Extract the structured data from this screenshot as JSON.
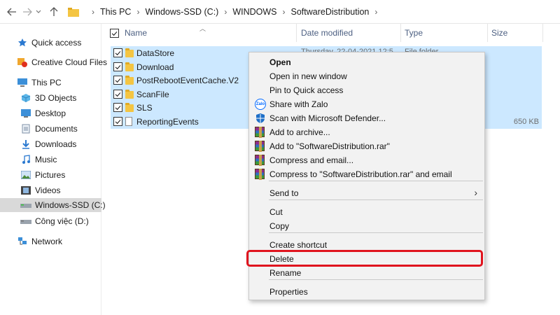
{
  "address": {
    "crumbs": [
      "This PC",
      "Windows-SSD (C:)",
      "WINDOWS",
      "SoftwareDistribution"
    ],
    "icons": {
      "back": "arrow-left-icon",
      "forward": "arrow-right-icon",
      "recent": "chevron-down-icon",
      "up": "arrow-up-icon",
      "folder": "folder-icon",
      "separator": "chevron-right-icon"
    }
  },
  "sidebar": {
    "items": [
      {
        "label": "Quick access",
        "icon": "star-icon"
      },
      {
        "label": "Creative Cloud Files",
        "icon": "creative-cloud-icon"
      },
      {
        "label": "This PC",
        "icon": "computer-icon"
      },
      {
        "label": "3D Objects",
        "icon": "cube-icon"
      },
      {
        "label": "Desktop",
        "icon": "desktop-icon"
      },
      {
        "label": "Documents",
        "icon": "documents-icon"
      },
      {
        "label": "Downloads",
        "icon": "download-icon"
      },
      {
        "label": "Music",
        "icon": "music-icon"
      },
      {
        "label": "Pictures",
        "icon": "pictures-icon"
      },
      {
        "label": "Videos",
        "icon": "video-icon"
      },
      {
        "label": "Windows-SSD (C:)",
        "icon": "drive-icon"
      },
      {
        "label": "Công việc (D:)",
        "icon": "drive-icon"
      },
      {
        "label": "Network",
        "icon": "network-icon"
      }
    ],
    "selected": "Windows-SSD (C:)"
  },
  "columns": {
    "name": "Name",
    "date_modified": "Date modified",
    "type": "Type",
    "size": "Size"
  },
  "files": [
    {
      "name": "DataStore",
      "kind": "folder",
      "size": ""
    },
    {
      "name": "Download",
      "kind": "folder",
      "size": ""
    },
    {
      "name": "PostRebootEventCache.V2",
      "kind": "folder",
      "size": ""
    },
    {
      "name": "ScanFile",
      "kind": "folder",
      "size": ""
    },
    {
      "name": "SLS",
      "kind": "folder",
      "size": ""
    },
    {
      "name": "ReportingEvents",
      "kind": "file",
      "size": "650 KB"
    }
  ],
  "partial_text": {
    "date": "Thursday, 22-04-2021 12:5",
    "type": "File folder"
  },
  "context_menu": {
    "items": [
      {
        "label": "Open",
        "bold": true,
        "icon": ""
      },
      {
        "label": "Open in new window",
        "icon": ""
      },
      {
        "label": "Pin to Quick access",
        "icon": ""
      },
      {
        "label": "Share with Zalo",
        "icon": "zalo-icon"
      },
      {
        "label": "Scan with Microsoft Defender...",
        "icon": "shield-icon"
      },
      {
        "label": "Add to archive...",
        "icon": "winrar-icon"
      },
      {
        "label": "Add to \"SoftwareDistribution.rar\"",
        "icon": "winrar-icon"
      },
      {
        "label": "Compress and email...",
        "icon": "winrar-icon"
      },
      {
        "label": "Compress to \"SoftwareDistribution.rar\" and email",
        "icon": "winrar-icon"
      },
      {
        "label": "Send to",
        "icon": "",
        "submenu": true
      },
      {
        "label": "Cut",
        "icon": ""
      },
      {
        "label": "Copy",
        "icon": ""
      },
      {
        "label": "Create shortcut",
        "icon": ""
      },
      {
        "label": "Delete",
        "icon": "",
        "highlighted": true
      },
      {
        "label": "Rename",
        "icon": ""
      },
      {
        "label": "Properties",
        "icon": ""
      }
    ],
    "icon_texts": {
      "zalo": "Zalo"
    }
  },
  "colors": {
    "selection": "#cce8ff",
    "highlight": "#e0141e",
    "menu_bg": "#f2f2f2",
    "header_text": "#4d6082"
  }
}
